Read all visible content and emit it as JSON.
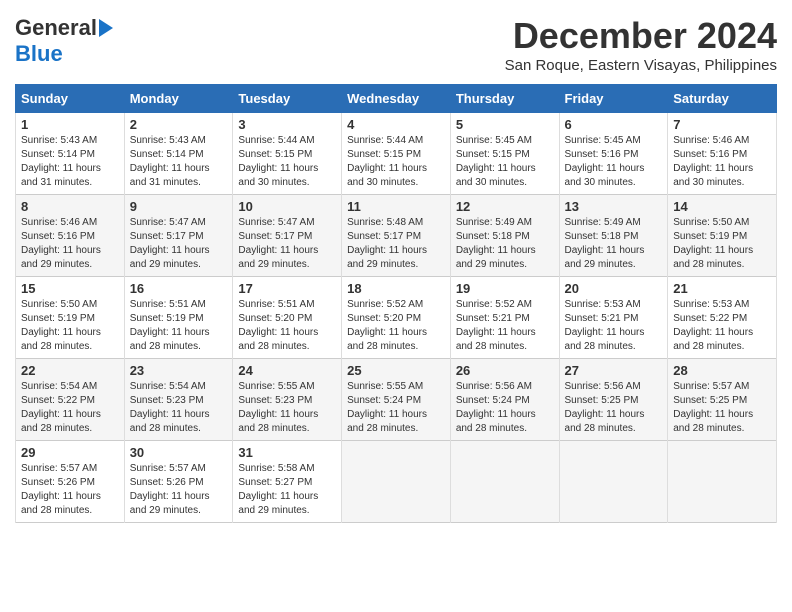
{
  "header": {
    "logo_general": "General",
    "logo_blue": "Blue",
    "month_title": "December 2024",
    "location": "San Roque, Eastern Visayas, Philippines"
  },
  "weekdays": [
    "Sunday",
    "Monday",
    "Tuesday",
    "Wednesday",
    "Thursday",
    "Friday",
    "Saturday"
  ],
  "weeks": [
    [
      {
        "day": "1",
        "sunrise": "5:43 AM",
        "sunset": "5:14 PM",
        "daylight": "11 hours and 31 minutes."
      },
      {
        "day": "2",
        "sunrise": "5:43 AM",
        "sunset": "5:14 PM",
        "daylight": "11 hours and 31 minutes."
      },
      {
        "day": "3",
        "sunrise": "5:44 AM",
        "sunset": "5:15 PM",
        "daylight": "11 hours and 30 minutes."
      },
      {
        "day": "4",
        "sunrise": "5:44 AM",
        "sunset": "5:15 PM",
        "daylight": "11 hours and 30 minutes."
      },
      {
        "day": "5",
        "sunrise": "5:45 AM",
        "sunset": "5:15 PM",
        "daylight": "11 hours and 30 minutes."
      },
      {
        "day": "6",
        "sunrise": "5:45 AM",
        "sunset": "5:16 PM",
        "daylight": "11 hours and 30 minutes."
      },
      {
        "day": "7",
        "sunrise": "5:46 AM",
        "sunset": "5:16 PM",
        "daylight": "11 hours and 30 minutes."
      }
    ],
    [
      {
        "day": "8",
        "sunrise": "5:46 AM",
        "sunset": "5:16 PM",
        "daylight": "11 hours and 29 minutes."
      },
      {
        "day": "9",
        "sunrise": "5:47 AM",
        "sunset": "5:17 PM",
        "daylight": "11 hours and 29 minutes."
      },
      {
        "day": "10",
        "sunrise": "5:47 AM",
        "sunset": "5:17 PM",
        "daylight": "11 hours and 29 minutes."
      },
      {
        "day": "11",
        "sunrise": "5:48 AM",
        "sunset": "5:17 PM",
        "daylight": "11 hours and 29 minutes."
      },
      {
        "day": "12",
        "sunrise": "5:49 AM",
        "sunset": "5:18 PM",
        "daylight": "11 hours and 29 minutes."
      },
      {
        "day": "13",
        "sunrise": "5:49 AM",
        "sunset": "5:18 PM",
        "daylight": "11 hours and 29 minutes."
      },
      {
        "day": "14",
        "sunrise": "5:50 AM",
        "sunset": "5:19 PM",
        "daylight": "11 hours and 28 minutes."
      }
    ],
    [
      {
        "day": "15",
        "sunrise": "5:50 AM",
        "sunset": "5:19 PM",
        "daylight": "11 hours and 28 minutes."
      },
      {
        "day": "16",
        "sunrise": "5:51 AM",
        "sunset": "5:19 PM",
        "daylight": "11 hours and 28 minutes."
      },
      {
        "day": "17",
        "sunrise": "5:51 AM",
        "sunset": "5:20 PM",
        "daylight": "11 hours and 28 minutes."
      },
      {
        "day": "18",
        "sunrise": "5:52 AM",
        "sunset": "5:20 PM",
        "daylight": "11 hours and 28 minutes."
      },
      {
        "day": "19",
        "sunrise": "5:52 AM",
        "sunset": "5:21 PM",
        "daylight": "11 hours and 28 minutes."
      },
      {
        "day": "20",
        "sunrise": "5:53 AM",
        "sunset": "5:21 PM",
        "daylight": "11 hours and 28 minutes."
      },
      {
        "day": "21",
        "sunrise": "5:53 AM",
        "sunset": "5:22 PM",
        "daylight": "11 hours and 28 minutes."
      }
    ],
    [
      {
        "day": "22",
        "sunrise": "5:54 AM",
        "sunset": "5:22 PM",
        "daylight": "11 hours and 28 minutes."
      },
      {
        "day": "23",
        "sunrise": "5:54 AM",
        "sunset": "5:23 PM",
        "daylight": "11 hours and 28 minutes."
      },
      {
        "day": "24",
        "sunrise": "5:55 AM",
        "sunset": "5:23 PM",
        "daylight": "11 hours and 28 minutes."
      },
      {
        "day": "25",
        "sunrise": "5:55 AM",
        "sunset": "5:24 PM",
        "daylight": "11 hours and 28 minutes."
      },
      {
        "day": "26",
        "sunrise": "5:56 AM",
        "sunset": "5:24 PM",
        "daylight": "11 hours and 28 minutes."
      },
      {
        "day": "27",
        "sunrise": "5:56 AM",
        "sunset": "5:25 PM",
        "daylight": "11 hours and 28 minutes."
      },
      {
        "day": "28",
        "sunrise": "5:57 AM",
        "sunset": "5:25 PM",
        "daylight": "11 hours and 28 minutes."
      }
    ],
    [
      {
        "day": "29",
        "sunrise": "5:57 AM",
        "sunset": "5:26 PM",
        "daylight": "11 hours and 28 minutes."
      },
      {
        "day": "30",
        "sunrise": "5:57 AM",
        "sunset": "5:26 PM",
        "daylight": "11 hours and 29 minutes."
      },
      {
        "day": "31",
        "sunrise": "5:58 AM",
        "sunset": "5:27 PM",
        "daylight": "11 hours and 29 minutes."
      },
      null,
      null,
      null,
      null
    ]
  ],
  "labels": {
    "sunrise_prefix": "Sunrise: ",
    "sunset_prefix": "Sunset: ",
    "daylight_prefix": "Daylight: "
  }
}
